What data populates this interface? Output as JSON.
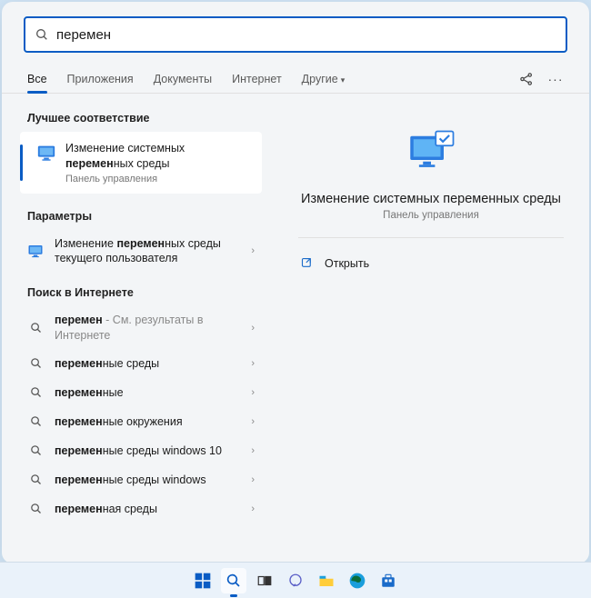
{
  "search": {
    "query": "перемен"
  },
  "tabs": {
    "all": "Все",
    "apps": "Приложения",
    "docs": "Документы",
    "internet": "Интернет",
    "other": "Другие"
  },
  "sections": {
    "best": "Лучшее соответствие",
    "params": "Параметры",
    "web": "Поиск в Интернете"
  },
  "best_match": {
    "title_pre": "Изменение системных ",
    "title_bold": "перемен",
    "title_post": "ных среды",
    "subtitle": "Панель управления"
  },
  "params_items": [
    {
      "pre": "Изменение ",
      "bold": "перемен",
      "post": "ных среды текущего пользователя"
    }
  ],
  "web_items": [
    {
      "bold": "перемен",
      "post": "",
      "suffix": " - См. результаты в Интернете"
    },
    {
      "bold": "перемен",
      "post": "ные среды"
    },
    {
      "bold": "перемен",
      "post": "ные"
    },
    {
      "bold": "перемен",
      "post": "ные окружения"
    },
    {
      "bold": "перемен",
      "post": "ные среды windows 10"
    },
    {
      "bold": "перемен",
      "post": "ные среды windows"
    },
    {
      "bold": "перемен",
      "post": "ная среды"
    }
  ],
  "preview": {
    "title": "Изменение системных переменных среды",
    "subtitle": "Панель управления",
    "open": "Открыть"
  }
}
